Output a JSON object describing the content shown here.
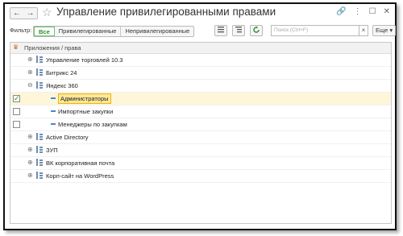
{
  "window": {
    "title": "Управление привилегированными правами",
    "nav": {
      "back": "←",
      "forward": "→"
    },
    "star": "☆",
    "icons": [
      "link-icon",
      "more-vert-icon",
      "maximize-icon",
      "close-icon"
    ],
    "icon_glyphs": {
      "link": "🔗",
      "more": "⋮",
      "max": "☐",
      "close": "✕"
    }
  },
  "toolbar": {
    "filter_label": "Фильтр:",
    "filters": [
      "Все",
      "Привилегированные",
      "Непривилегированные"
    ],
    "active_filter": "Все",
    "search_placeholder": "Поиск (Ctrl+F)",
    "search_clear": "×",
    "more_label": "Еще ▾"
  },
  "grid": {
    "column_header": "Приложения / права",
    "rows": [
      {
        "label": "Управление торговлей 10.3",
        "level": 0,
        "expander": "⊕",
        "checked": null
      },
      {
        "label": "Битрикс 24",
        "level": 0,
        "expander": "⊕",
        "checked": null
      },
      {
        "label": "Яндекс 360",
        "level": 0,
        "expander": "⊖",
        "checked": null
      },
      {
        "label": "Администраторы",
        "level": 1,
        "checked": true,
        "selected": true
      },
      {
        "label": "Импортные закупки",
        "level": 1,
        "checked": false
      },
      {
        "label": "Менеджеры по закупкам",
        "level": 1,
        "checked": false
      },
      {
        "label": "Active Directory",
        "level": 0,
        "expander": "⊕",
        "checked": null
      },
      {
        "label": "ЗУП",
        "level": 0,
        "expander": "⊕",
        "checked": null
      },
      {
        "label": "ВК корпоративная почта",
        "level": 0,
        "expander": "⊕",
        "checked": null
      },
      {
        "label": "Корп-сайт на WordPress",
        "level": 0,
        "expander": "⊕",
        "checked": null
      }
    ]
  }
}
